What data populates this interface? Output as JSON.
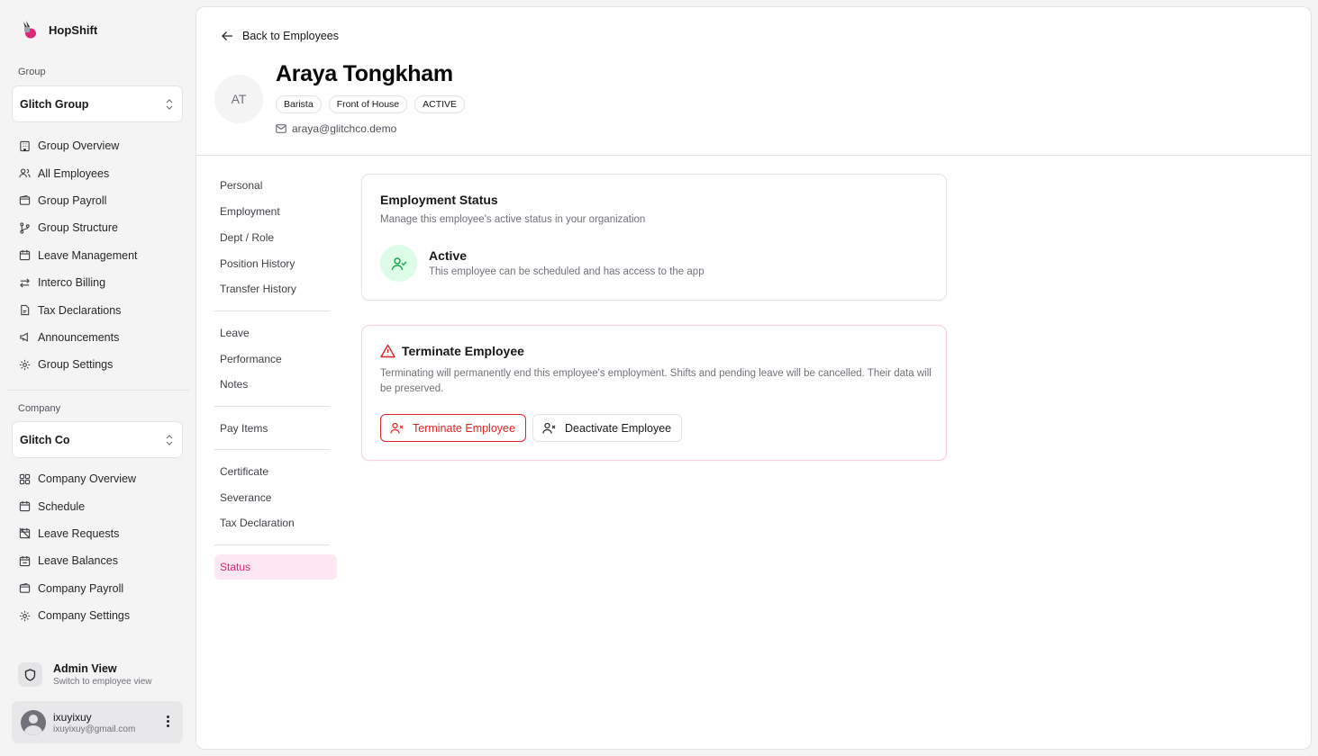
{
  "brand": {
    "name": "HopShift"
  },
  "sidebar": {
    "group_label": "Group",
    "group_selector": "Glitch Group",
    "group_items": [
      {
        "label": "Group Overview",
        "icon": "building-icon"
      },
      {
        "label": "All Employees",
        "icon": "users-icon"
      },
      {
        "label": "Group Payroll",
        "icon": "wallet-icon"
      },
      {
        "label": "Group Structure",
        "icon": "git-branch-icon"
      },
      {
        "label": "Leave Management",
        "icon": "calendar-icon"
      },
      {
        "label": "Interco Billing",
        "icon": "arrows-exchange-icon"
      },
      {
        "label": "Tax Declarations",
        "icon": "file-icon"
      },
      {
        "label": "Announcements",
        "icon": "megaphone-icon"
      },
      {
        "label": "Group Settings",
        "icon": "gear-icon"
      }
    ],
    "company_label": "Company",
    "company_selector": "Glitch Co",
    "company_items": [
      {
        "label": "Company Overview",
        "icon": "grid-icon"
      },
      {
        "label": "Schedule",
        "icon": "calendar-icon"
      },
      {
        "label": "Leave Requests",
        "icon": "calendar-off-icon"
      },
      {
        "label": "Leave Balances",
        "icon": "calendar-check-icon"
      },
      {
        "label": "Company Payroll",
        "icon": "wallet-icon"
      },
      {
        "label": "Company Settings",
        "icon": "gear-icon"
      }
    ],
    "admin": {
      "title": "Admin View",
      "subtitle": "Switch to employee view"
    },
    "user": {
      "name": "ixuyixuy",
      "email": "ixuyixuy@gmail.com"
    }
  },
  "header": {
    "back_label": "Back to Employees",
    "avatar_initials": "AT",
    "name": "Araya Tongkham",
    "badges": [
      "Barista",
      "Front of House",
      "ACTIVE"
    ],
    "email": "araya@glitchco.demo"
  },
  "subnav": {
    "groups": [
      [
        "Personal",
        "Employment",
        "Dept / Role",
        "Position History",
        "Transfer History"
      ],
      [
        "Leave",
        "Performance",
        "Notes"
      ],
      [
        "Pay Items"
      ],
      [
        "Certificate",
        "Severance",
        "Tax Declaration"
      ],
      [
        "Status"
      ]
    ],
    "active": "Status"
  },
  "employment_status": {
    "title": "Employment Status",
    "description": "Manage this employee's active status in your organization",
    "status_title": "Active",
    "status_description": "This employee can be scheduled and has access to the app"
  },
  "terminate": {
    "title": "Terminate Employee",
    "description": "Terminating will permanently end this employee's employment. Shifts and pending leave will be cancelled. Their data will be preserved.",
    "terminate_button": "Terminate Employee",
    "deactivate_button": "Deactivate Employee"
  },
  "colors": {
    "accent": "#db2777",
    "danger": "#dc2626",
    "success": "#16a34a"
  }
}
